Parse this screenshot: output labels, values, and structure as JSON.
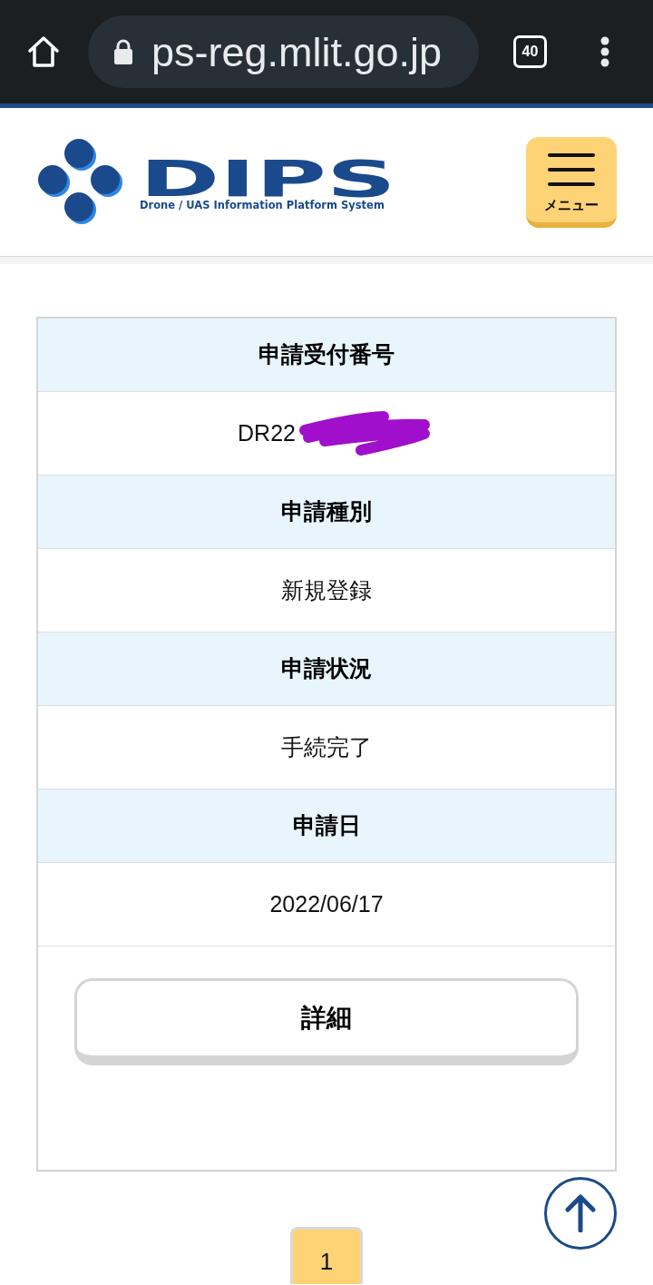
{
  "browser": {
    "url": "ps-reg.mlit.go.jp",
    "tab_count": "40"
  },
  "header": {
    "logo": {
      "title": "DIPS",
      "subtitle": "Drone / UAS Information Platform System"
    },
    "menu_button": {
      "label": "メニュー"
    }
  },
  "application": {
    "fields": [
      {
        "label": "申請受付番号",
        "value": "DR22",
        "redacted": true
      },
      {
        "label": "申請種別",
        "value": "新規登録",
        "redacted": false
      },
      {
        "label": "申請状況",
        "value": "手続完了",
        "redacted": false
      },
      {
        "label": "申請日",
        "value": "2022/06/17",
        "redacted": false
      }
    ],
    "detail_button": "詳細"
  },
  "pagination": [
    {
      "label": "1",
      "selected": true
    }
  ]
}
